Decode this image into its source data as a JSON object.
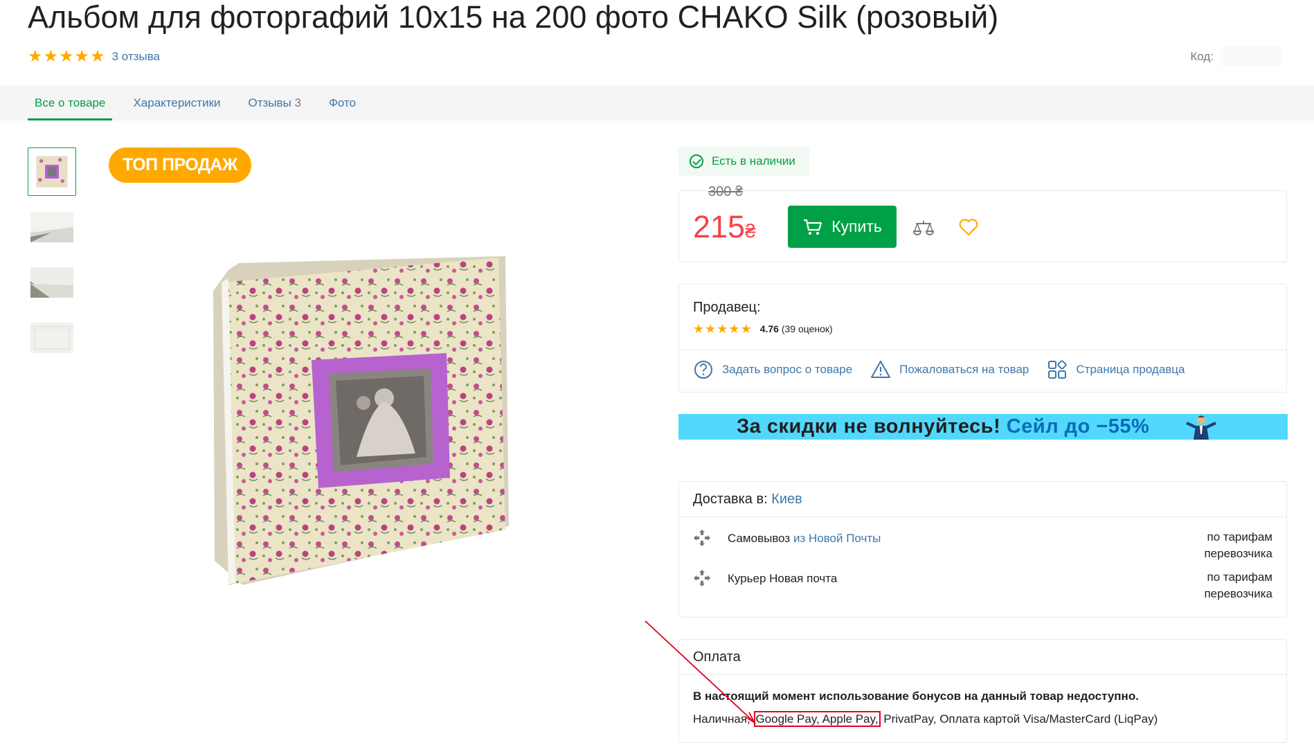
{
  "product": {
    "title": "Альбом для фоторгафий 10х15 на 200 фото CHAKO Silk (розовый)",
    "reviews_link": "3 отзыва",
    "code_label": "Код:",
    "rating_stars": 5
  },
  "tabs": [
    {
      "label": "Все о товаре",
      "active": true
    },
    {
      "label": "Характеристики"
    },
    {
      "label": "Отзывы",
      "count": "3"
    },
    {
      "label": "Фото"
    }
  ],
  "badge": "ТОП ПРОДАЖ",
  "availability": "Есть в наличии",
  "price": {
    "old": "300 ₴",
    "current": "215",
    "currency": "₴",
    "buy_label": "Купить"
  },
  "seller": {
    "title": "Продавец:",
    "score": "4.76",
    "count": "(39 оценок)",
    "links": [
      {
        "label": "Задать вопрос о товаре",
        "icon": "question-icon"
      },
      {
        "label": "Пожаловаться на товар",
        "icon": "warning-icon"
      },
      {
        "label": "Страница продавца",
        "icon": "shop-icon"
      }
    ]
  },
  "banner": {
    "text_dark": "За скидки не волнуйтесь!",
    "text_blue": "Сейл до −55%"
  },
  "delivery": {
    "title": "Доставка в:",
    "city": "Киев",
    "rows": [
      {
        "name": "Самовывоз",
        "link": "из Новой Почты",
        "price_line1": "по тарифам",
        "price_line2": "перевозчика"
      },
      {
        "name": "Курьер Новая почта",
        "link": "",
        "price_line1": "по тарифам",
        "price_line2": "перевозчика"
      }
    ]
  },
  "payment": {
    "title": "Оплата",
    "note": "В настоящий момент использование бонусов на данный товар недоступно.",
    "methods_before": "Наличная, ",
    "methods_highlight": "Google Pay, Apple Pay,",
    "methods_after": " PrivatPay, Оплата картой Visa/MasterCard (LiqPay)"
  },
  "colors": {
    "accent_green": "#00a046",
    "price_red": "#f84147",
    "link_blue": "#3e77aa",
    "star_orange": "#ffa900",
    "banner_cyan": "#52d8fd",
    "annotation_red": "#e3001b"
  }
}
